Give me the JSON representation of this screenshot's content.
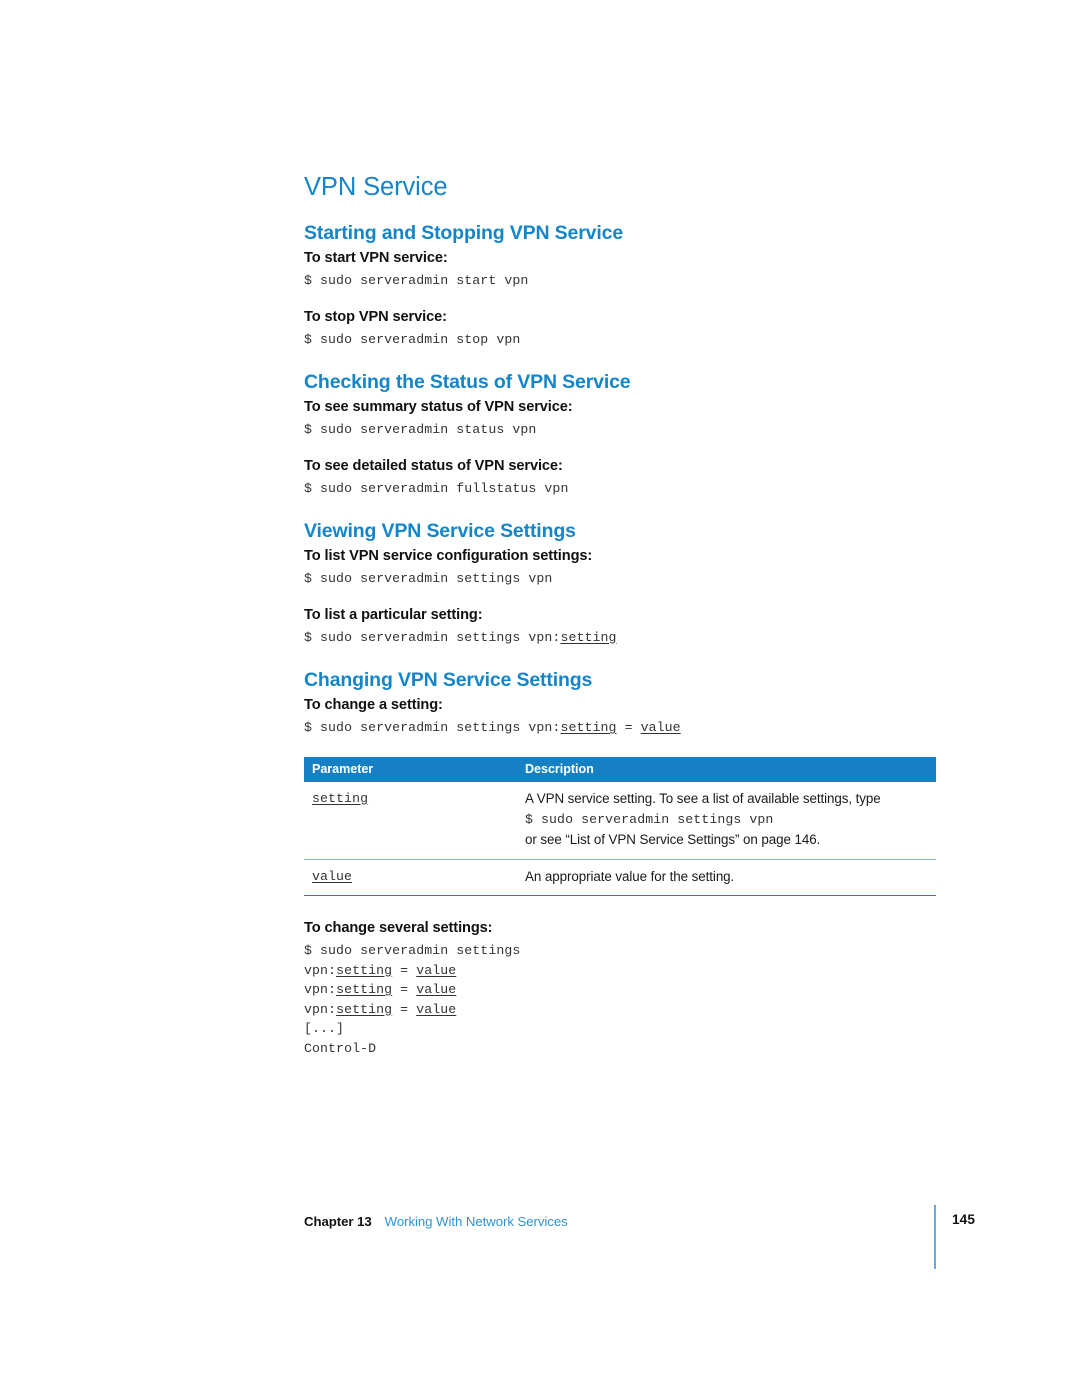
{
  "document": {
    "page_title": "VPN Service"
  },
  "sections": [
    {
      "heading": "Starting and Stopping VPN Service",
      "items": [
        {
          "label": "To start VPN service:",
          "code": "$ sudo serveradmin start vpn"
        },
        {
          "label": "To stop VPN service:",
          "code": "$ sudo serveradmin stop vpn"
        }
      ]
    },
    {
      "heading": "Checking the Status of VPN Service",
      "items": [
        {
          "label": "To see summary status of VPN service:",
          "code": "$ sudo serveradmin status vpn"
        },
        {
          "label": "To see detailed status of VPN service:",
          "code": "$ sudo serveradmin fullstatus vpn"
        }
      ]
    },
    {
      "heading": "Viewing VPN Service Settings",
      "items": [
        {
          "label": "To list VPN service configuration settings:",
          "code": "$ sudo serveradmin settings vpn"
        },
        {
          "label": "To list a particular setting:",
          "code_prefix": "$ sudo serveradmin settings vpn:",
          "code_placeholder": "setting"
        }
      ]
    },
    {
      "heading": "Changing VPN Service Settings",
      "items": [
        {
          "label": "To change a setting:",
          "code_prefix": "$ sudo serveradmin settings vpn:",
          "code_placeholder": "setting",
          "code_mid": " = ",
          "code_placeholder2": "value"
        }
      ]
    }
  ],
  "table": {
    "headers": [
      "Parameter",
      "Description"
    ],
    "rows": [
      {
        "parameter": "setting",
        "description_line1": "A VPN service setting. To see a list of available settings, type",
        "description_code": "$ sudo serveradmin settings vpn",
        "description_line2": "or see “List of VPN Service Settings” on page 146."
      },
      {
        "parameter": "value",
        "description_line1": "An appropriate value for the setting."
      }
    ]
  },
  "multi_setting": {
    "label": "To change several settings:",
    "line1": "$ sudo serveradmin settings",
    "lines": [
      {
        "prefix": "vpn:",
        "placeholder": "setting",
        "mid": " = ",
        "placeholder2": "value"
      },
      {
        "prefix": "vpn:",
        "placeholder": "setting",
        "mid": " = ",
        "placeholder2": "value"
      },
      {
        "prefix": "vpn:",
        "placeholder": "setting",
        "mid": " = ",
        "placeholder2": "value"
      }
    ],
    "ellipsis": "[...]",
    "end": "Control-D"
  },
  "footer": {
    "chapter": "Chapter 13",
    "chapter_name": "Working With Network Services",
    "page_number": "145"
  },
  "colors": {
    "heading_blue": "#1585C9",
    "table_header_blue": "#1581C4",
    "row_rule_blue": "#83BBDF",
    "footer_link_blue": "#2E93D1"
  }
}
